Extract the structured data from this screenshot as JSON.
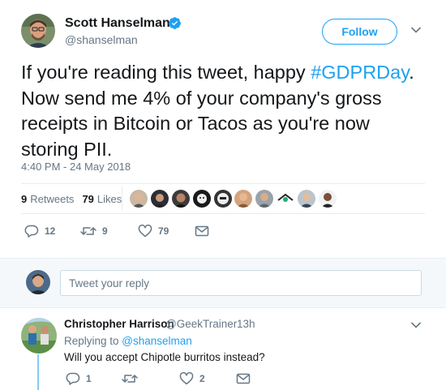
{
  "author": {
    "name": "Scott Hanselman",
    "handle": "@shanselman",
    "verified": true
  },
  "follow_label": "Follow",
  "tweet": {
    "text_before": "If you're reading this tweet, happy ",
    "hashtag": "#GDPRDay",
    "text_after": ". Now send me 4% of your company's gross receipts in Bitcoin or Tacos as you're now storing PII.",
    "timestamp": "4:40 PM - 24 May 2018"
  },
  "stats": {
    "retweets_count": "9",
    "retweets_label": "Retweets",
    "likes_count": "79",
    "likes_label": "Likes"
  },
  "actions": {
    "replies": "12",
    "retweets": "9",
    "likes": "79"
  },
  "reply_box": {
    "placeholder": "Tweet your reply"
  },
  "reply": {
    "name": "Christopher Harrison",
    "handle": "@GeekTrainer",
    "separator": "·",
    "time": "13h",
    "replying_prefix": "Replying to ",
    "replying_to": "@shanselman",
    "text": "Will you accept Chipotle burritos instead?",
    "replies": "1",
    "retweets": "",
    "likes": "2"
  },
  "colors": {
    "accent": "#1da1f2",
    "muted": "#657786",
    "text": "#14171a",
    "border": "#e6ecf0"
  },
  "icons": [
    "verified-badge-icon",
    "chevron-down-icon",
    "reply-icon",
    "retweet-icon",
    "heart-icon",
    "direct-message-icon"
  ]
}
